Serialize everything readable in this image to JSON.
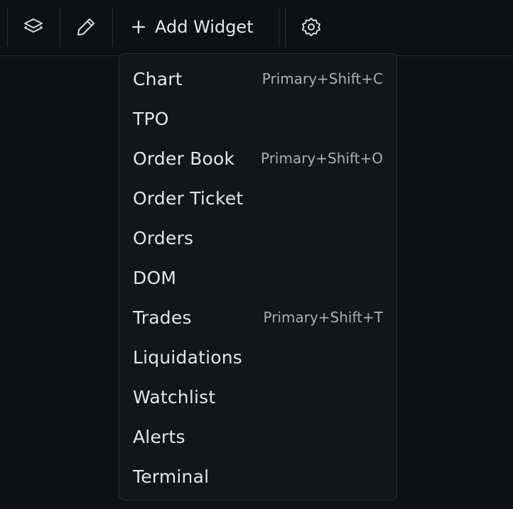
{
  "toolbar": {
    "layers_icon": "layers-icon",
    "draw_icon": "pencil-icon",
    "add_widget_label": "Add Widget",
    "settings_icon": "gear-icon"
  },
  "menu": {
    "items": [
      {
        "label": "Chart",
        "shortcut": "Primary+Shift+C"
      },
      {
        "label": "TPO",
        "shortcut": ""
      },
      {
        "label": "Order Book",
        "shortcut": "Primary+Shift+O"
      },
      {
        "label": "Order Ticket",
        "shortcut": ""
      },
      {
        "label": "Orders",
        "shortcut": ""
      },
      {
        "label": "DOM",
        "shortcut": ""
      },
      {
        "label": "Trades",
        "shortcut": "Primary+Shift+T"
      },
      {
        "label": "Liquidations",
        "shortcut": ""
      },
      {
        "label": "Watchlist",
        "shortcut": ""
      },
      {
        "label": "Alerts",
        "shortcut": ""
      },
      {
        "label": "Terminal",
        "shortcut": ""
      }
    ]
  },
  "colors": {
    "background": "#0e1017",
    "menu_background": "#13151c",
    "text": "#e2e5ec",
    "shortcut_text": "#a9adb8"
  }
}
